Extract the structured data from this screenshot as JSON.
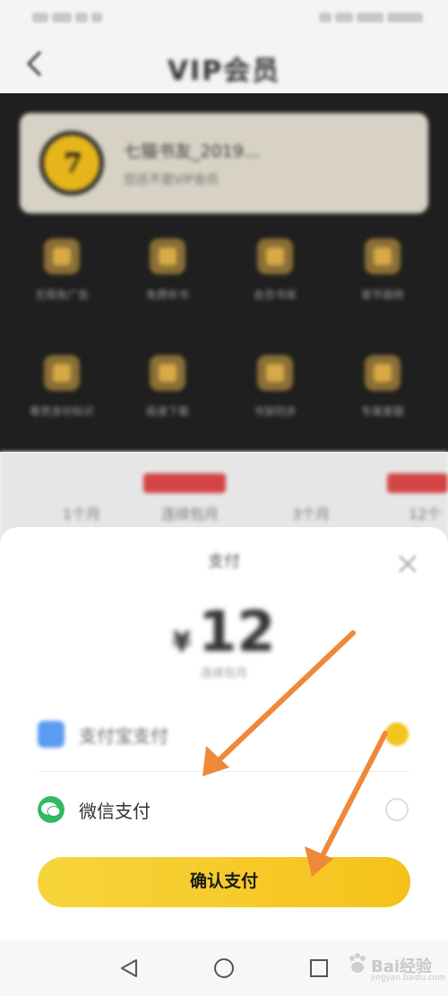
{
  "header": {
    "title": "VIP会员"
  },
  "member": {
    "name": "七猫书友_2019...",
    "subtitle": "您还不是VIP会员"
  },
  "benefits": [
    {
      "label": "无限免广告"
    },
    {
      "label": "免费听书"
    },
    {
      "label": "会员书库"
    },
    {
      "label": "章节跳转"
    },
    {
      "label": "尊贵身份标识"
    },
    {
      "label": "极速下载"
    },
    {
      "label": "书架同步"
    },
    {
      "label": "专属客服"
    }
  ],
  "plans": [
    {
      "label": "1个月"
    },
    {
      "label": "连续包月"
    },
    {
      "label": "3个月"
    },
    {
      "label": "12个月"
    }
  ],
  "sheet": {
    "title": "支付",
    "currency": "¥",
    "amount": "12",
    "note": "连续包月",
    "payment_methods": [
      {
        "label": "支付宝支付",
        "selected": true
      },
      {
        "label": "微信支付",
        "selected": false
      }
    ],
    "confirm_label": "确认支付"
  },
  "watermark": {
    "brand": "Bai经验",
    "url": "jingyan.baidu.com"
  },
  "colors": {
    "accent": "#f5c21a",
    "arrow": "#f0883a",
    "wechat": "#2fb960",
    "alipay": "#5a9cf3"
  }
}
